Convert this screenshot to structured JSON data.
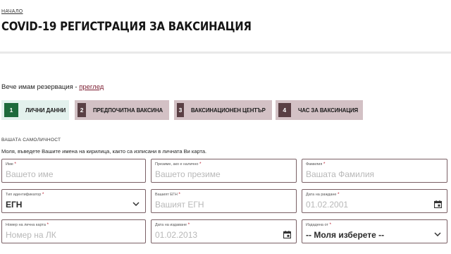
{
  "header": {
    "breadcrumb": "НАЧАЛО",
    "title": "COVID-19 РЕГИСТРАЦИЯ ЗА ВАКСИНАЦИЯ"
  },
  "reservation": {
    "text": "Вече имам резервация - ",
    "link": "преглед"
  },
  "steps": [
    {
      "number": "1",
      "label": "ЛИЧНИ ДАННИ",
      "active": true
    },
    {
      "number": "2",
      "label": "ПРЕДПОЧИТНА ВАКСИНА",
      "active": false
    },
    {
      "number": "3",
      "label": "ВАКСИНАЦИОНЕН ЦЕНТЪР",
      "active": false
    },
    {
      "number": "4",
      "label": "ЧАС ЗА ВАКСИНАЦИЯ",
      "active": false
    }
  ],
  "identity": {
    "section_title": "ВАШАТА САМОЛИЧНОСТ",
    "hint": "Моля, въведете Вашите имена на кирилица, както са изписани в личната Ви карта."
  },
  "fields": {
    "first_name": {
      "label": "Име",
      "required": "*",
      "placeholder": "Вашето име"
    },
    "middle_name": {
      "label": "Презиме, ако е налично",
      "required": "*",
      "placeholder": "Вашето презиме"
    },
    "last_name": {
      "label": "Фамилия",
      "required": "*",
      "placeholder": "Вашата Фамилия"
    },
    "id_type": {
      "label": "Тип идентификатор",
      "required": "*",
      "value": "ЕГН"
    },
    "egn": {
      "label": "Вашият ЕГН",
      "required": "*",
      "placeholder": "Вашият ЕГН"
    },
    "birth_date": {
      "label": "Дата на раждане",
      "required": "*",
      "placeholder": "01.02.2001"
    },
    "id_card_number": {
      "label": "Номер на лична карта",
      "required": "*",
      "placeholder": "Номер на ЛК"
    },
    "issue_date": {
      "label": "Дата на издаване",
      "required": "*",
      "placeholder": "01.02.2013"
    },
    "issued_by": {
      "label": "Издадена от",
      "required": "*",
      "value": "-- Моля изберете --"
    }
  },
  "icons": {
    "select": "chevron-down-icon",
    "date": "calendar-icon"
  },
  "colors": {
    "accent": "#7a1a2e",
    "step_active_bg": "#e3f1ed",
    "step_active_num": "#1e6a3c",
    "step_inactive_bg": "#d3c1c5",
    "step_inactive_num": "#5a3f44",
    "required": "#b81d2e"
  }
}
